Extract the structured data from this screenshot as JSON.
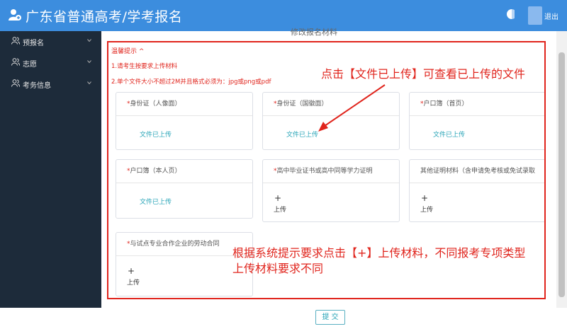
{
  "header": {
    "title": "广东省普通高考/学考报名",
    "logout": "退出",
    "logo_icon": "user-plus-icon",
    "toggle_icon": "half-moon-icon"
  },
  "sidebar": {
    "items": [
      {
        "label": "预报名",
        "icon": "users-icon"
      },
      {
        "label": "志愿",
        "icon": "users-icon"
      },
      {
        "label": "考务信息",
        "icon": "users-icon"
      }
    ]
  },
  "main": {
    "page_title": "修改报名材料",
    "notice": {
      "title": "温馨提示 ^",
      "lines": [
        "1.请考生按要求上传材料",
        "2.单个文件大小不超过2M并且格式必须为：jpg或png或pdf"
      ]
    },
    "cards": [
      {
        "label_req": "*",
        "label": "身份证（人像面）",
        "status": "文件已上传"
      },
      {
        "label_req": "*",
        "label": "身份证（国徽面）",
        "status": "文件已上传"
      },
      {
        "label_req": "*",
        "label": "户口簿（首页）",
        "status": "文件已上传"
      },
      {
        "label_req": "*",
        "label": "户口簿（本人页）",
        "status": "文件已上传"
      },
      {
        "label_req": "*",
        "label": "高中毕业证书或高中同等学力证明",
        "plus": "+",
        "upload": "上传"
      },
      {
        "label_req": "",
        "label": "其他证明材料（含申请免考核或免试录取",
        "plus": "+",
        "upload": "上传"
      },
      {
        "label_req": "*",
        "label": "与试点专业合作企业的劳动合同",
        "plus": "+",
        "upload": "上传"
      }
    ],
    "callout_top": "点击【文件已上传】可查看已上传的文件",
    "callout_bottom_1": "根据系统提示要求点击【+】上传材料，不同报考专项类型",
    "callout_bottom_2": "上传材料要求不同",
    "submit": "提 交"
  },
  "colors": {
    "header_bg": "#3c8dde",
    "sidebar_bg": "#1d2b3a",
    "annotation_red": "#e0241c",
    "link_teal": "#27a4b7"
  }
}
